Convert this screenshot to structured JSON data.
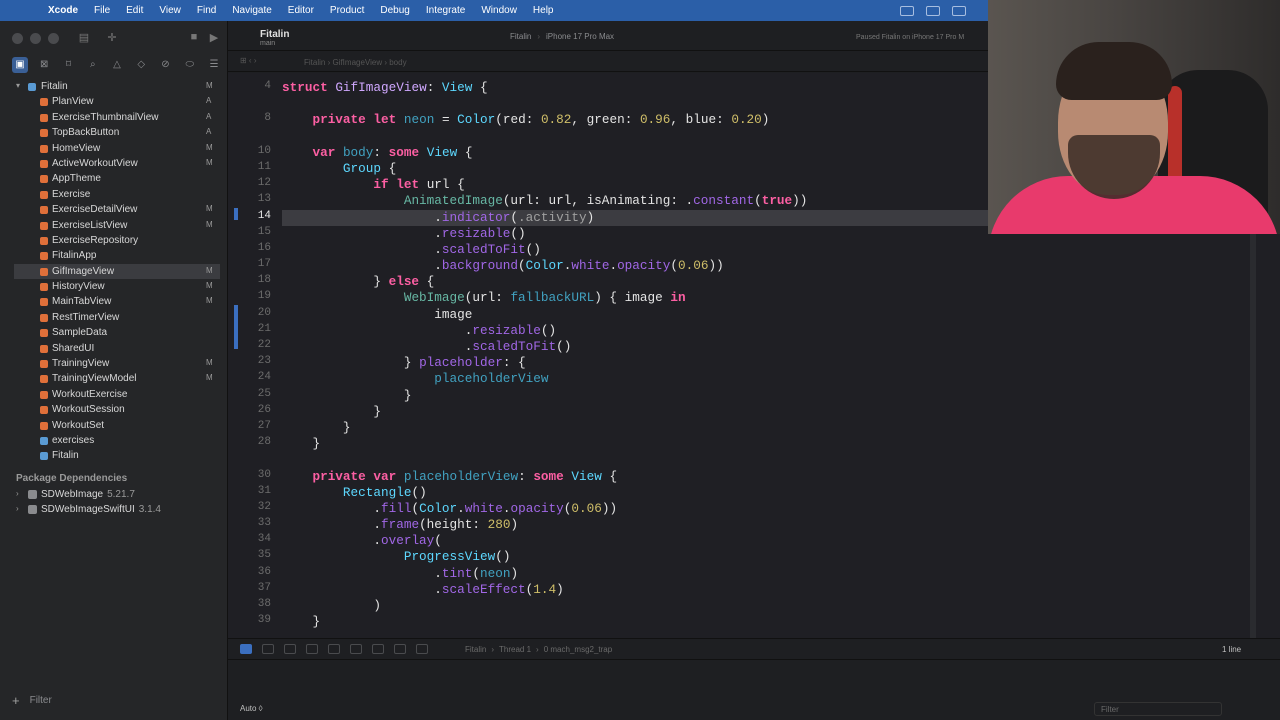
{
  "menubar": {
    "app": "Xcode",
    "items": [
      "File",
      "Edit",
      "View",
      "Find",
      "Navigate",
      "Editor",
      "Product",
      "Debug",
      "Integrate",
      "Window",
      "Help"
    ]
  },
  "toolbar": {
    "project_title": "Fitalin",
    "branch": "main",
    "scheme": "Fitalin",
    "destination": "iPhone 17 Pro Max",
    "run_status": "Paused Fitalin on iPhone 17 Pro M"
  },
  "breadcrumb": {
    "items": [
      "Fitalin",
      "GifImageView",
      "body"
    ]
  },
  "sidebar": {
    "root": "Fitalin",
    "root_badge": "M",
    "files": [
      {
        "label": "PlanView",
        "badge": "A"
      },
      {
        "label": "ExerciseThumbnailView",
        "badge": "A"
      },
      {
        "label": "TopBackButton",
        "badge": "A"
      },
      {
        "label": "HomeView",
        "badge": "M"
      },
      {
        "label": "ActiveWorkoutView",
        "badge": "M"
      },
      {
        "label": "AppTheme",
        "badge": ""
      },
      {
        "label": "Exercise",
        "badge": ""
      },
      {
        "label": "ExerciseDetailView",
        "badge": "M"
      },
      {
        "label": "ExerciseListView",
        "badge": "M"
      },
      {
        "label": "ExerciseRepository",
        "badge": ""
      },
      {
        "label": "FitalinApp",
        "badge": ""
      },
      {
        "label": "GifImageView",
        "badge": "M"
      },
      {
        "label": "HistoryView",
        "badge": "M"
      },
      {
        "label": "MainTabView",
        "badge": "M"
      },
      {
        "label": "RestTimerView",
        "badge": ""
      },
      {
        "label": "SampleData",
        "badge": ""
      },
      {
        "label": "SharedUI",
        "badge": ""
      },
      {
        "label": "TrainingView",
        "badge": "M"
      },
      {
        "label": "TrainingViewModel",
        "badge": "M"
      },
      {
        "label": "WorkoutExercise",
        "badge": ""
      },
      {
        "label": "WorkoutSession",
        "badge": ""
      },
      {
        "label": "WorkoutSet",
        "badge": ""
      },
      {
        "label": "exercises",
        "badge": ""
      },
      {
        "label": "Fitalin",
        "badge": ""
      }
    ],
    "packages_header": "Package Dependencies",
    "packages": [
      {
        "name": "SDWebImage",
        "version": "5.21.7"
      },
      {
        "name": "SDWebImageSwiftUI",
        "version": "3.1.4"
      }
    ],
    "filter_placeholder": "Filter"
  },
  "editor": {
    "line_numbers": [
      "4",
      "",
      "8",
      "",
      "10",
      "11",
      "12",
      "13",
      "14",
      "15",
      "16",
      "17",
      "18",
      "19",
      "20",
      "21",
      "22",
      "23",
      "24",
      "25",
      "26",
      "27",
      "28",
      "",
      "30",
      "31",
      "32",
      "33",
      "34",
      "35",
      "36",
      "37",
      "38",
      "39"
    ],
    "current_line": "14"
  },
  "debug_bar": {
    "crumbs": [
      "Fitalin",
      "Thread 1",
      "0 mach_msg2_trap"
    ],
    "line_count": "1 line"
  },
  "console": {
    "mode": "Auto ◊",
    "filter_placeholder": "Filter"
  }
}
